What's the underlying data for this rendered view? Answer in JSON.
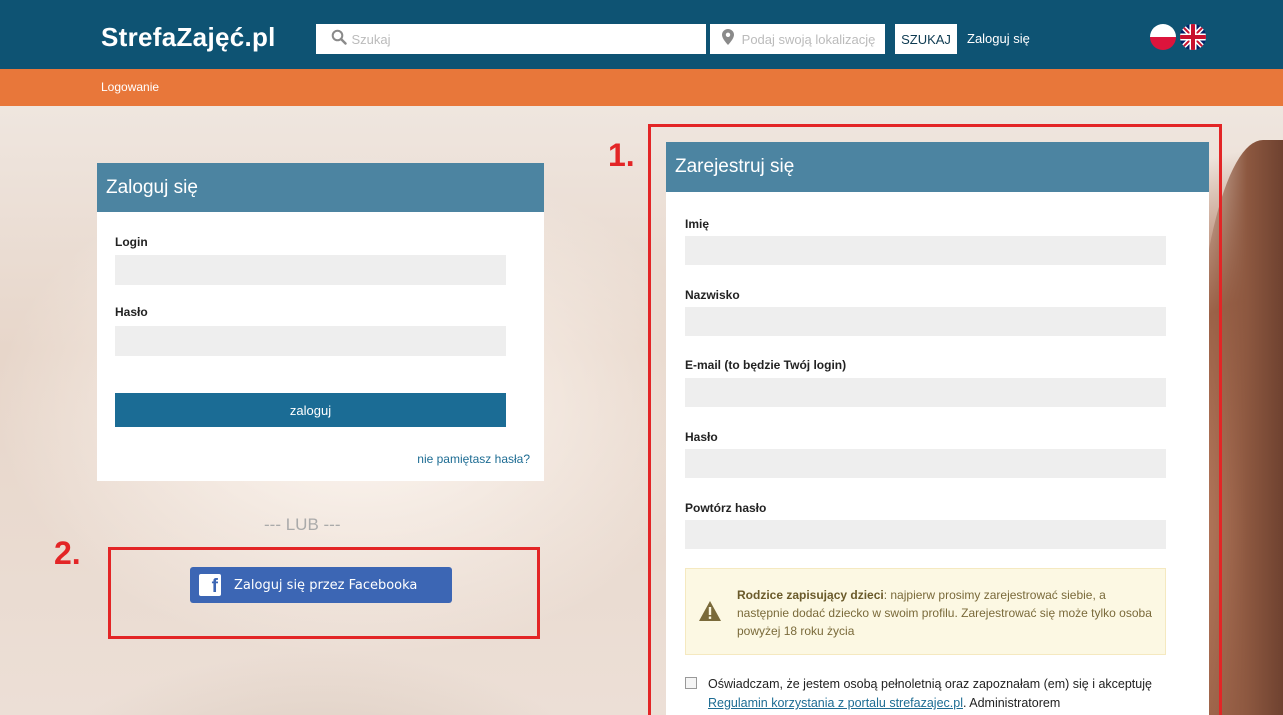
{
  "header": {
    "logo": "StrefaZajęć.pl",
    "search_placeholder": "Szukaj",
    "location_placeholder": "Podaj swoją lokalizację",
    "search_button": "SZUKAJ",
    "login_link": "Zaloguj się",
    "languages": [
      "pl-flag-icon",
      "uk-flag-icon"
    ]
  },
  "breadcrumb": "Logowanie",
  "login": {
    "title": "Zaloguj się",
    "login_label": "Login",
    "password_label": "Hasło",
    "submit": "zaloguj",
    "forgot": "nie pamiętasz hasła?"
  },
  "or_text": "--- LUB ---",
  "facebook_button": "Zaloguj się przez Facebooka",
  "annotations": {
    "one": "1.",
    "two": "2."
  },
  "register": {
    "title": "Zarejestruj się",
    "first_name_label": "Imię",
    "last_name_label": "Nazwisko",
    "email_label": "E-mail (to będzie Twój login)",
    "password_label": "Hasło",
    "repeat_password_label": "Powtórz hasło",
    "warning_bold": "Rodzice zapisujący dzieci",
    "warning_text": ": najpierw prosimy zarejestrować siebie, a następnie dodać dziecko w swoim profilu. Zarejestrować się może tylko osoba powyżej 18 roku życia",
    "consent_before": "Oświadczam, że jestem osobą pełnoletnią oraz zapoznałam (em) się i akceptuję ",
    "consent_link": "Regulamin korzystania z portalu strefazajec.pl",
    "consent_after": ". Administratorem"
  },
  "colors": {
    "header_bg": "#0e5373",
    "orange_bar": "#e8773a",
    "panel_head": "#4c84a1",
    "login_button": "#1b6c95",
    "facebook": "#3c66b4",
    "annotation_red": "#e32526"
  }
}
